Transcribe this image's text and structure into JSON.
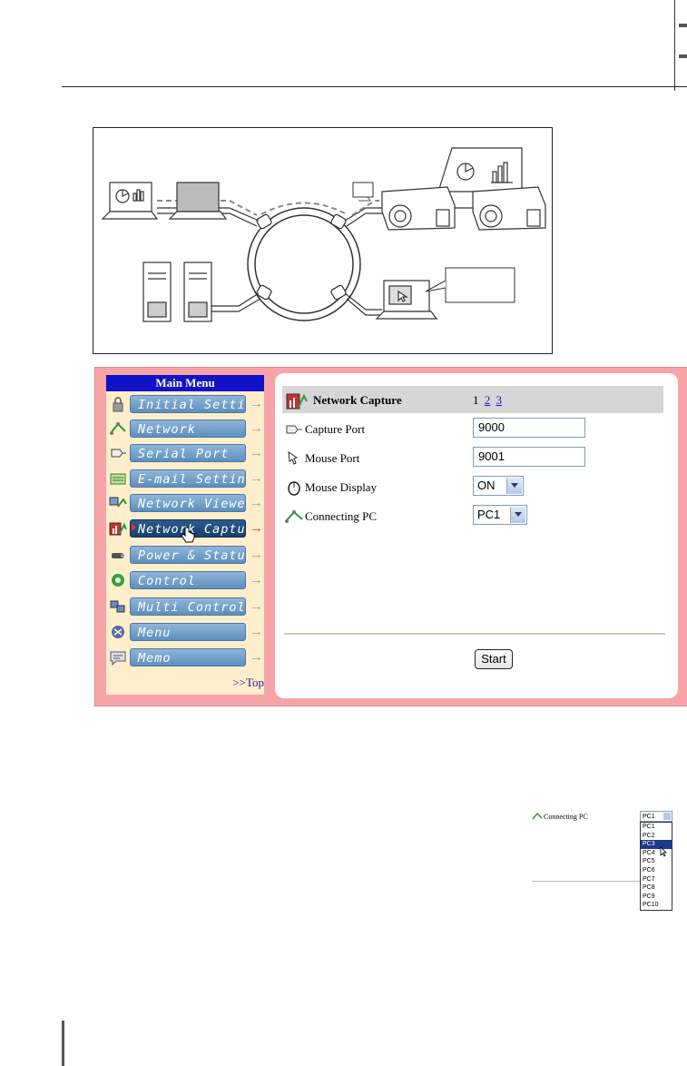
{
  "menu": {
    "title": "Main Menu",
    "items": [
      {
        "label": "Initial Setting",
        "icon": "lock-icon"
      },
      {
        "label": "Network",
        "icon": "network-icon"
      },
      {
        "label": "Serial Port",
        "icon": "serial-port-icon"
      },
      {
        "label": "E-mail Setting",
        "icon": "email-icon"
      },
      {
        "label": "Network Viewer",
        "icon": "network-viewer-icon"
      },
      {
        "label": "Network Capture",
        "icon": "network-capture-icon",
        "active": true
      },
      {
        "label": "Power & Status",
        "icon": "power-icon"
      },
      {
        "label": "Control",
        "icon": "control-icon"
      },
      {
        "label": "Multi Control",
        "icon": "multi-control-icon"
      },
      {
        "label": "Menu",
        "icon": "menu-icon"
      },
      {
        "label": "Memo",
        "icon": "memo-icon"
      }
    ],
    "top_link": ">>Top"
  },
  "content": {
    "title": "Network Capture",
    "page_current": "1",
    "pages": [
      "2",
      "3"
    ],
    "rows": {
      "capture_port": {
        "label": "Capture Port",
        "value": "9000"
      },
      "mouse_port": {
        "label": "Mouse Port",
        "value": "9001"
      },
      "mouse_display": {
        "label": "Mouse Display",
        "value": "ON"
      },
      "connecting_pc": {
        "label": "Connecting PC",
        "value": "PC1"
      }
    },
    "start_label": "Start"
  },
  "dropdown_example": {
    "label": "Connecting PC",
    "selected": "PC1",
    "options": [
      "PC1",
      "PC2",
      "PC3",
      "PC4",
      "PC5",
      "PC6",
      "PC7",
      "PC8",
      "PC9",
      "PC10"
    ],
    "highlighted": "PC3"
  },
  "colors": {
    "panel_bg": "#f7a4a8",
    "menu_bg": "#ffeecb",
    "menu_title_bg": "#1111c8",
    "button_active": "#18416d",
    "link": "#1a1ad0"
  }
}
